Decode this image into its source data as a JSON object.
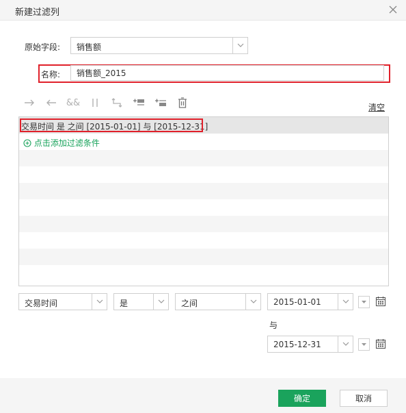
{
  "dialog": {
    "title": "新建过滤列"
  },
  "fields": {
    "source_label": "原始字段:",
    "source_value": "销售额",
    "name_label": "名称:",
    "name_value": "销售额_2015"
  },
  "toolbar": {
    "clear_label": "清空",
    "icons": [
      "arrow-right-icon",
      "arrow-left-icon",
      "and-icon",
      "or-icon",
      "return-icon",
      "add-before-icon",
      "add-after-icon",
      "trash-icon"
    ]
  },
  "conditions": {
    "rows": [
      "交易时间 是 之间 [2015-01-01] 与 [2015-12-31]"
    ],
    "add_label": "点击添加过滤条件"
  },
  "editor": {
    "field": "交易时间",
    "is": "是",
    "operator": "之间",
    "start_date": "2015-01-01",
    "and_label": "与",
    "end_date": "2015-12-31"
  },
  "footer": {
    "ok_label": "确定",
    "cancel_label": "取消"
  },
  "colors": {
    "accent_green": "#1aa35c",
    "highlight_red": "#e0202a"
  }
}
